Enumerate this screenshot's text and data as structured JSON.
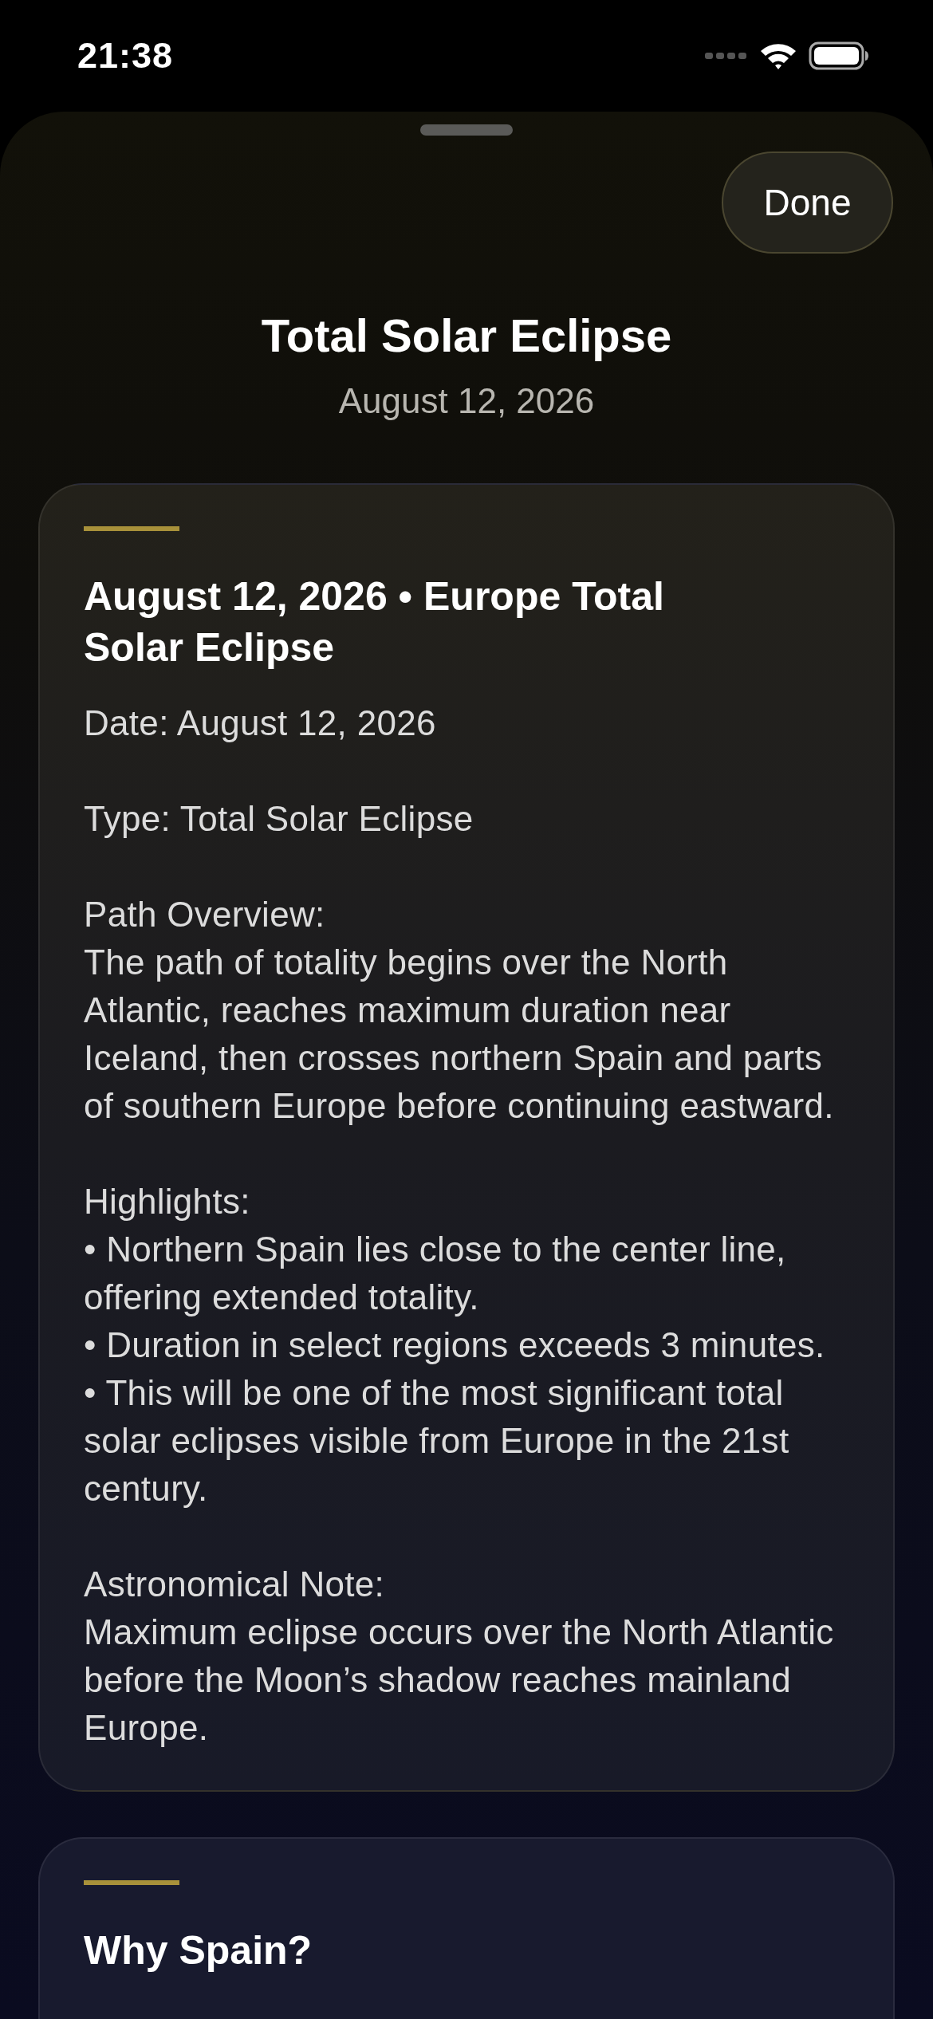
{
  "status_bar": {
    "time": "21:38"
  },
  "sheet": {
    "done_button": "Done",
    "title": "Total Solar Eclipse",
    "subtitle": "August 12, 2026"
  },
  "cards": [
    {
      "title": "August 12, 2026 • Europe Total Solar Eclipse",
      "paragraphs": [
        "Date: August 12, 2026",
        "Type: Total Solar Eclipse",
        "Path Overview:\nThe path of totality begins over the North Atlantic, reaches maximum duration near Iceland, then crosses northern Spain and parts of southern Europe before continuing eastward.",
        "Highlights:\n• Northern Spain lies close to the center line, offering extended totality.\n• Duration in select regions exceeds 3 minutes.\n• This will be one of the most significant total solar eclipses visible from Europe in the 21st century.",
        "Astronomical Note:\nMaximum eclipse occurs over the North Atlantic before the Moon’s shadow reaches mainland Europe."
      ]
    },
    {
      "title": "Why Spain?"
    }
  ]
}
